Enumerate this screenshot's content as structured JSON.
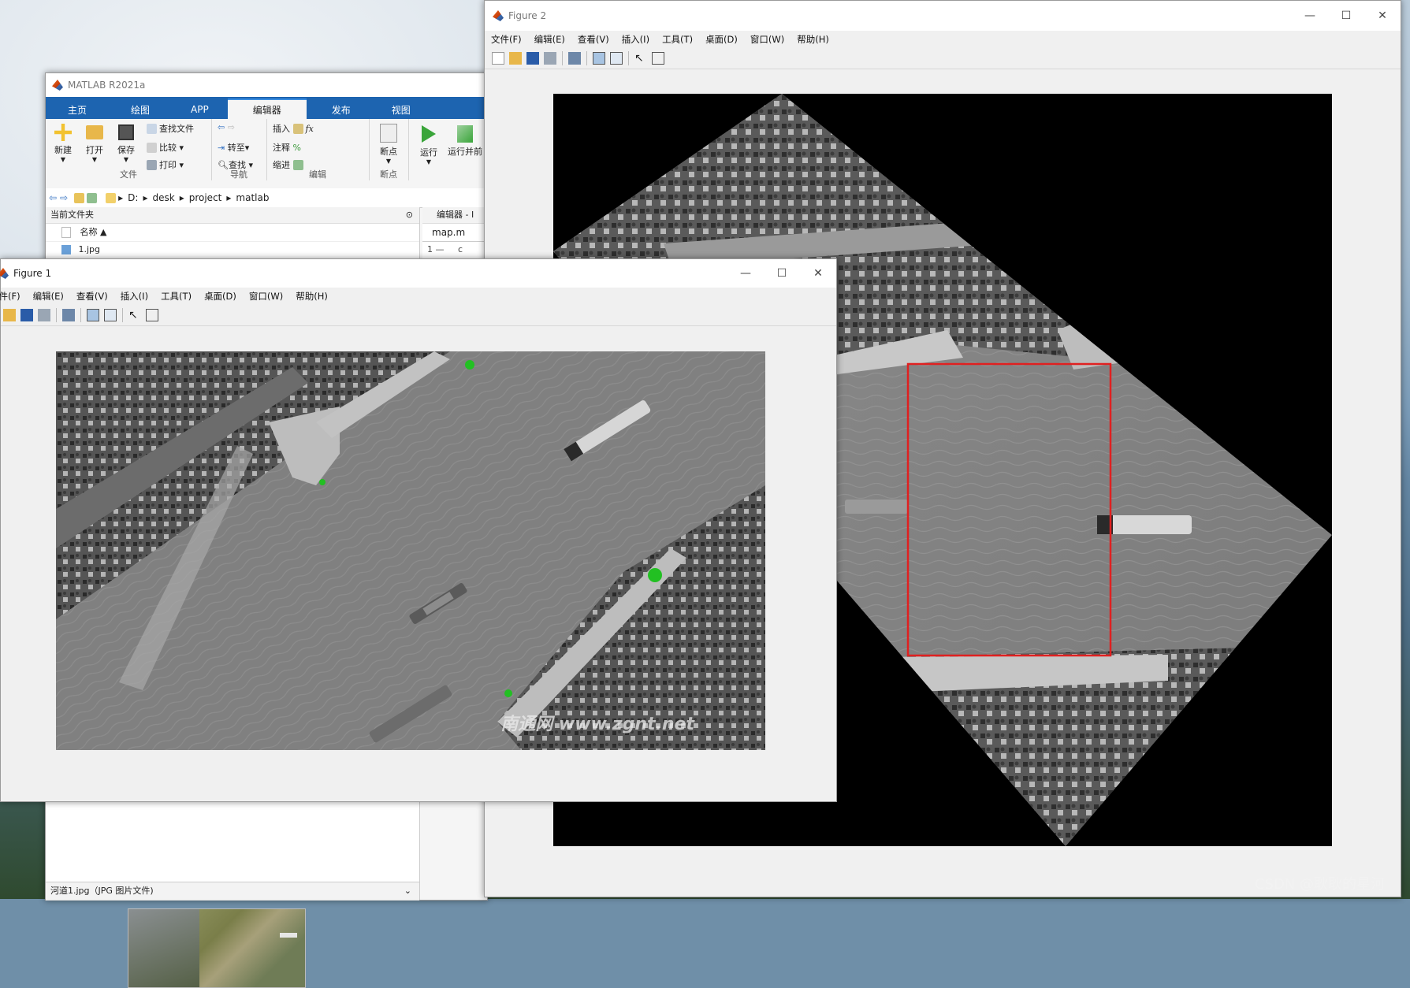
{
  "matlab": {
    "title": "MATLAB R2021a",
    "tabs": [
      "主页",
      "绘图",
      "APP",
      "编辑器",
      "发布",
      "视图"
    ],
    "ribbon": {
      "new": "新建",
      "open": "打开",
      "save": "保存",
      "find_files": "查找文件",
      "compare": "比较",
      "print": "打印",
      "goto": "转至",
      "find": "查找",
      "insert": "插入",
      "comment": "注释",
      "indent": "缩进",
      "fx": "fx",
      "percent": "%",
      "breakpoints": "断点",
      "run": "运行",
      "run_advance": "运行并前进",
      "group_file": "文件",
      "group_nav": "导航",
      "group_edit": "编辑",
      "group_bp": "断点"
    },
    "path": [
      "D:",
      "desk",
      "project",
      "matlab"
    ],
    "current_folder": {
      "label": "当前文件夹",
      "name_header": "名称",
      "files": [
        "1.jpg"
      ]
    },
    "editor": {
      "label": "编辑器 - I",
      "tab": "map.m",
      "line1_num": "1",
      "line1_mark": "—",
      "line1_text": "c"
    },
    "detail": {
      "file_label": "河道1.jpg（JPG 图片文件)"
    }
  },
  "figure1": {
    "title": "Figure 1",
    "menus": [
      "文件(F)",
      "编辑(E)",
      "查看(V)",
      "插入(I)",
      "工具(T)",
      "桌面(D)",
      "窗口(W)",
      "帮助(H)"
    ]
  },
  "figure2": {
    "title": "Figure 2",
    "menus": [
      "文件(F)",
      "编辑(E)",
      "查看(V)",
      "插入(I)",
      "工具(T)",
      "桌面(D)",
      "窗口(W)",
      "帮助(H)"
    ]
  },
  "window_controls": {
    "minimize": "—",
    "maximize": "☐",
    "close": "✕"
  },
  "watermark_image": "南通网 www.zgnt.net",
  "csdn_watermark": "CSDN @耿耿的星河",
  "colors": {
    "ribbon_blue": "#1d64b0",
    "red_box": "#e02020",
    "green_marker": "#22c022"
  }
}
